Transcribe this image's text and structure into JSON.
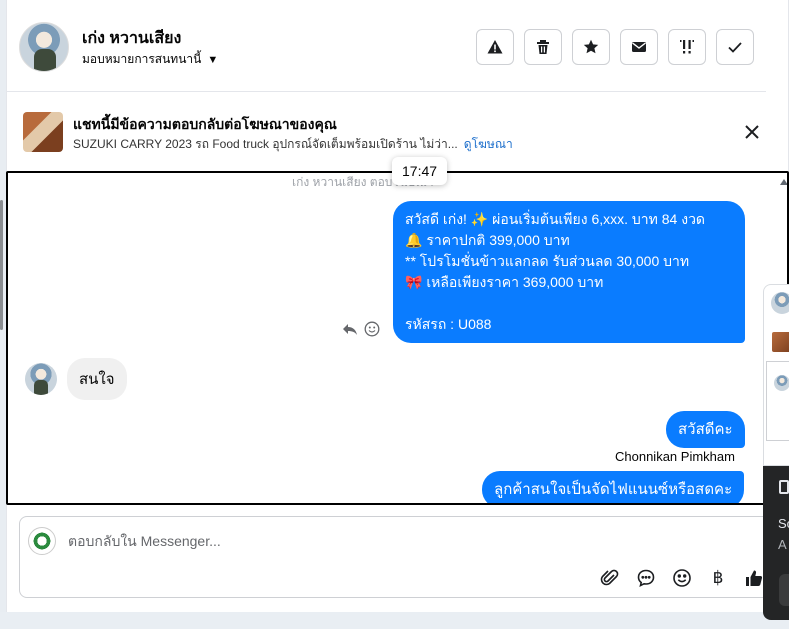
{
  "header": {
    "contact_name": "เก่ง หวานเสียง",
    "assign_label": "มอบหมายการสนทนานี้",
    "tools": [
      {
        "name": "report-icon"
      },
      {
        "name": "trash-icon"
      },
      {
        "name": "star-icon"
      },
      {
        "name": "mail-icon"
      },
      {
        "name": "follow-up-icon"
      },
      {
        "name": "done-icon"
      }
    ]
  },
  "ad": {
    "title": "แชทนี้มีข้อความตอบกลับต่อโฆษณาของคุณ",
    "description": "SUZUKI CARRY 2023 รถ Food truck อุปกรณ์จัดเต็มพร้อมเปิดร้าน ไม่ว่า...",
    "link": "ดูโฆษณา"
  },
  "conversation": {
    "faded_header": "เก่ง หวานเสียง ตอบโฆษณา",
    "tooltip_time": "17:47",
    "messages": {
      "offer_lines": [
        "สวัสดี เก่ง! ✨ ผ่อนเริ่มต้นเพียง 6,xxx. บาท 84 งวด",
        "🔔  ราคาปกติ 399,000 บาท",
        "** โปรโมชั่นข้าวแลกลด รับส่วนลด 30,000 บาท",
        "🎀 เหลือเพียงราคา 369,000 บาท",
        "",
        "รหัสรถ : U088"
      ],
      "reply_in": "สนใจ",
      "greeting": "สวัสดีคะ",
      "sender_name": "Chonnikan Pimkham",
      "last_message": "ลูกค้าสนใจเป็นจัดไฟแนนซ์หรือสดคะ"
    }
  },
  "composer": {
    "placeholder": "ตอบกลับใน Messenger...",
    "currency_symbol": "฿"
  },
  "side_panel": {
    "line1": "So",
    "line2": "A"
  },
  "colors": {
    "outgoing_bubble": "#0a7cff",
    "incoming_bubble": "#f0f0f0",
    "link": "#1d6fcc"
  }
}
